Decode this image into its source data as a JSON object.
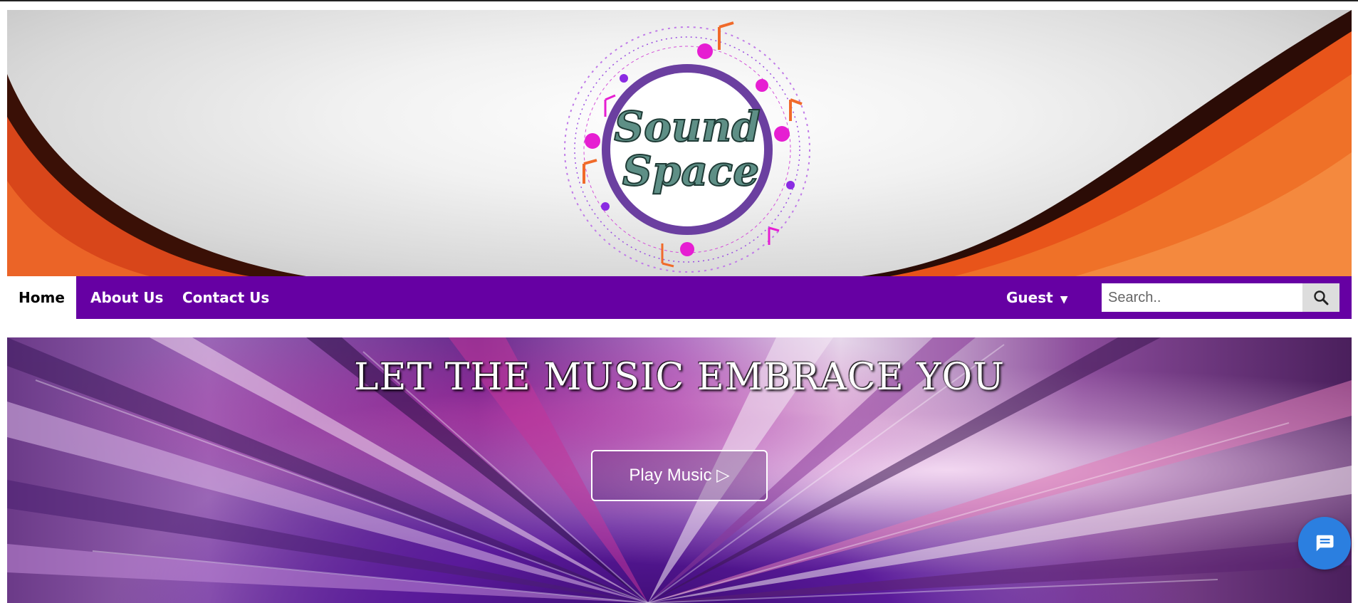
{
  "header": {
    "logo_text_line1": "Sound",
    "logo_text_line2": "Space"
  },
  "nav": {
    "items": [
      {
        "label": "Home",
        "active": true
      },
      {
        "label": "About Us",
        "active": false
      },
      {
        "label": "Contact Us",
        "active": false
      }
    ],
    "user_menu_label": "Guest",
    "search_placeholder": "Search.."
  },
  "hero": {
    "title": "LET THE MUSIC EMBRACE YOU",
    "button_label": "Play Music ▷"
  },
  "icons": {
    "search": "search-icon",
    "dropdown": "caret-down-icon",
    "chat": "chat-icon"
  },
  "colors": {
    "nav_bg": "#6600a3",
    "chat_bg": "#2b7fe0",
    "banner_accent": "#e8541a"
  }
}
